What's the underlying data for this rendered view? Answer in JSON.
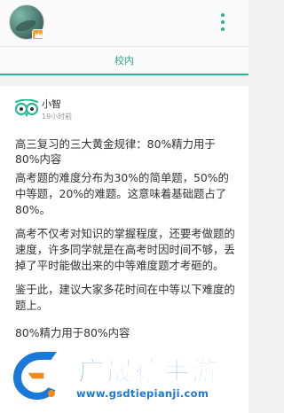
{
  "header": {
    "more_menu_icon": "more-vertical-icon"
  },
  "tabs": [
    {
      "label": "校内",
      "active": true
    }
  ],
  "post": {
    "author": "小智",
    "time": "19小时前",
    "title": "高三复习的三大黄金规律：80%精力用于80%内容",
    "paragraphs": [
      "高考题的难度分布为30%的简单题，50%的中等题，20%的难题。这意味着基础题占了80%。",
      "高考不仅考对知识的掌握程度，还要考做题的速度，许多同学就是在高考时因时间不够，丢掉了平时能做出来的中等难度题才考砸的。",
      "鉴于此，建议大家多花时间在中等以下难度的题上。",
      "80%精力用于80%内容"
    ]
  },
  "watermark": {
    "title": "广晟德手游",
    "url": "www.gsdtiepianji.com"
  },
  "colors": {
    "accent": "#2cb896",
    "watermark": "#1a78d8"
  }
}
